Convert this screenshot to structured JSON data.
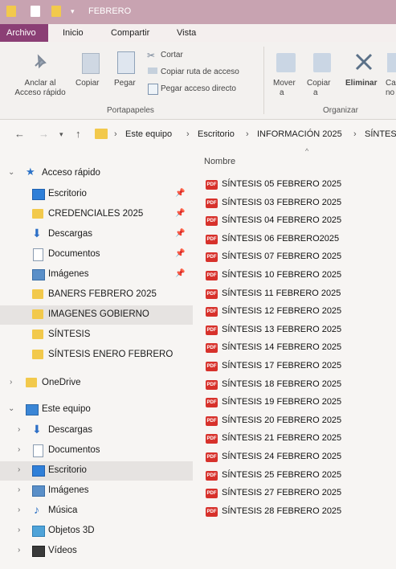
{
  "window": {
    "title": "FEBRERO"
  },
  "menu": {
    "archivo": "Archivo",
    "inicio": "Inicio",
    "compartir": "Compartir",
    "vista": "Vista"
  },
  "ribbon": {
    "anclar_line1": "Anclar al",
    "anclar_line2": "Acceso rápido",
    "copiar": "Copiar",
    "pegar": "Pegar",
    "cortar": "Cortar",
    "copiar_ruta": "Copiar ruta de acceso",
    "pegar_acceso": "Pegar acceso directo",
    "portapapeles": "Portapapeles",
    "mover_line1": "Mover",
    "mover_line2": "a",
    "copiar_a_line1": "Copiar",
    "copiar_a_line2": "a",
    "eliminar": "Eliminar",
    "cambiar_line1": "Ca",
    "cambiar_line2": "no",
    "organizar": "Organizar"
  },
  "address": {
    "crumbs": [
      "Este equipo",
      "Escritorio",
      "INFORMACIÓN 2025",
      "SÍNTES"
    ]
  },
  "nav_pane": {
    "quick_access": "Acceso rápido",
    "quick_items": [
      "Escritorio",
      "CREDENCIALES 2025",
      "Descargas",
      "Documentos",
      "Imágenes",
      "BANERS FEBRERO 2025",
      "IMAGENES GOBIERNO",
      "SÍNTESIS",
      "SÍNTESIS ENERO FEBRERO"
    ],
    "onedrive": "OneDrive",
    "este_equipo": "Este equipo",
    "pc_items": [
      "Descargas",
      "Documentos",
      "Escritorio",
      "Imágenes",
      "Música",
      "Objetos 3D",
      "Vídeos"
    ]
  },
  "file_list": {
    "column_name": "Nombre",
    "files": [
      "SÍNTESIS  05 FEBRERO 2025",
      "SÍNTESIS 03 FEBRERO 2025",
      "SÍNTESIS 04 FEBRERO 2025",
      "SÍNTESIS 06 FEBRERO2025",
      "SÍNTESIS 07 FEBRERO 2025",
      "SÍNTESIS 10 FEBRERO  2025",
      "SÍNTESIS 11 FEBRERO 2025",
      "SÍNTESIS 12 FEBRERO 2025",
      "SÍNTESIS 13 FEBRERO 2025",
      "SÍNTESIS 14 FEBRERO 2025",
      "SÍNTESIS 17 FEBRERO 2025",
      "SÍNTESIS 18 FEBRERO 2025",
      "SÍNTESIS 19 FEBRERO 2025",
      "SÍNTESIS 20 FEBRERO 2025",
      "SÍNTESIS 21 FEBRERO 2025",
      "SÍNTESIS 24 FEBRERO 2025",
      "SÍNTESIS 25 FEBRERO 2025",
      "SÍNTESIS 27 FEBRERO 2025",
      "SÍNTESIS 28 FEBRERO 2025"
    ],
    "file_icon_text": "PDF"
  },
  "colors": {
    "titlebar": "#c8a3b1",
    "archivo_tab": "#8b3f75",
    "pdf_red": "#d7312b",
    "folder": "#f2c94c",
    "selected_row": "#e6e3e1"
  }
}
